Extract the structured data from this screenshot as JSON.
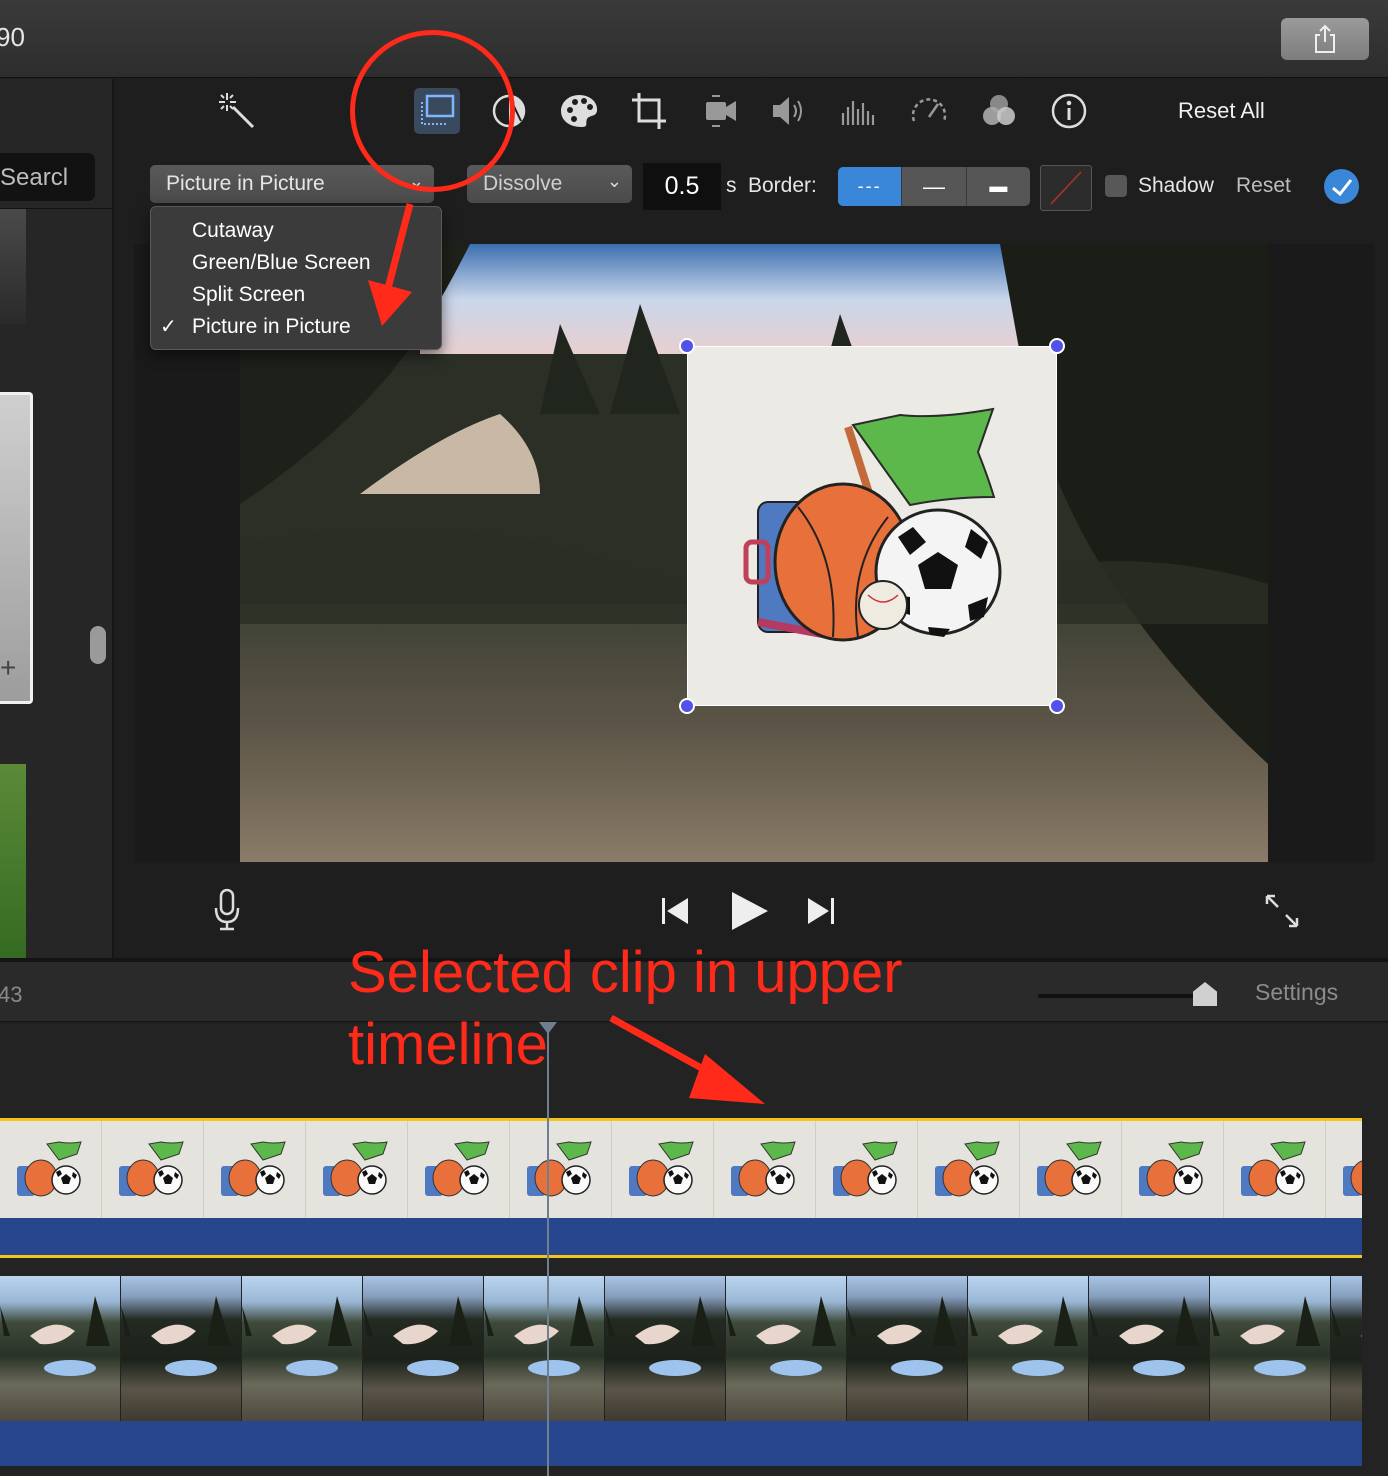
{
  "window": {
    "title_fragment": "90"
  },
  "sidebar": {
    "search_placeholder": "Searcl"
  },
  "toolbar": {
    "tools": [
      "magic-wand",
      "video-overlay",
      "color-balance",
      "color-correction",
      "crop",
      "stabilization",
      "volume",
      "noise-reduction",
      "speed",
      "clip-filter",
      "clip-info"
    ],
    "active_tool": "video-overlay",
    "reset_all_label": "Reset All"
  },
  "overlay": {
    "mode_selected": "Picture in Picture",
    "transition": "Dissolve",
    "duration": "0.5",
    "duration_unit": "s",
    "border_label": "Border:",
    "border_styles": [
      "---",
      "—",
      "▬"
    ],
    "border_active": "---",
    "shadow_label": "Shadow",
    "shadow_checked": false,
    "reset_label": "Reset",
    "menu_items": [
      {
        "label": "Cutaway",
        "checked": false
      },
      {
        "label": "Green/Blue Screen",
        "checked": false
      },
      {
        "label": "Split Screen",
        "checked": false
      },
      {
        "label": "Picture in Picture",
        "checked": true
      }
    ]
  },
  "timeline": {
    "timecode_fragment": "43",
    "settings_label": "Settings",
    "zoom_level": 0.97
  },
  "annotation": {
    "text_line1": "Selected clip in upper",
    "text_line2": "timeline",
    "color": "#ff2a1a"
  },
  "colors": {
    "accent_blue": "#3a86d8",
    "clip_selected_border": "#f5c518",
    "clip_bar": "#27468e",
    "handle": "#5252e8"
  }
}
